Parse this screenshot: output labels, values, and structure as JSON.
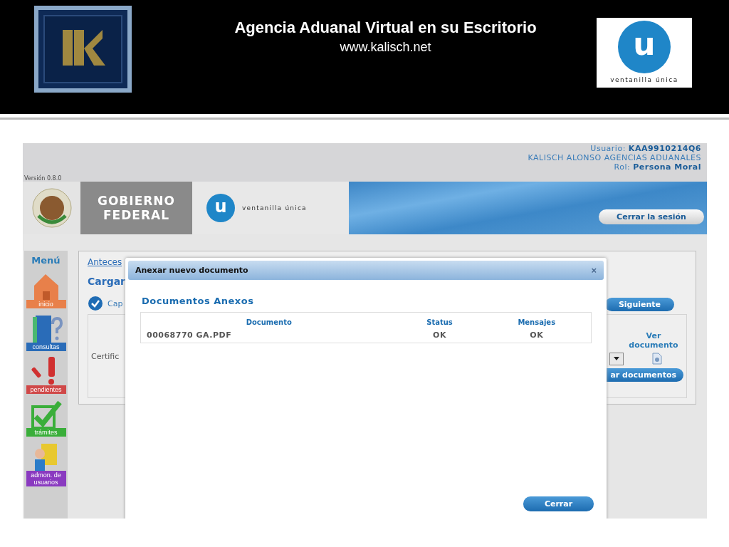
{
  "slide_header": {
    "title": "Agencia Aduanal Virtual en su Escritorio",
    "url": "www.kalisch.net",
    "logo_letter": "u",
    "logo_text": "ventanilla única"
  },
  "app": {
    "version": "Versión 0.8.0",
    "user": {
      "usuario_label": "Usuario:",
      "usuario": "KAA9910214Q6",
      "company": "KALISCH ALONSO AGENCIAS ADUANALES",
      "rol_label": "Rol:",
      "rol": "Persona Moral"
    },
    "banner": {
      "gobierno": "GOBIERNO FEDERAL",
      "logo_letter": "u",
      "logo_text": "ventanilla única",
      "logout": "Cerrar la sesión"
    },
    "menu": {
      "title": "Menú",
      "items": [
        {
          "label": "inicio",
          "kind": "house",
          "color": "#e8804a"
        },
        {
          "label": "consultas",
          "kind": "book",
          "color": "#2a6cb8"
        },
        {
          "label": "pendientes",
          "kind": "alert",
          "color": "#d04848"
        },
        {
          "label": "trámites",
          "kind": "check",
          "color": "#3aae3a"
        },
        {
          "label": "admon. de usuarios",
          "kind": "user",
          "color": "#8a3ac0"
        }
      ]
    },
    "page": {
      "breadcrumb": "Anteces",
      "heading": "Cargar",
      "step": "Cap",
      "next_button": "Siguiente",
      "field_label": "Certific",
      "view_column": "Ver documento",
      "attach_button": "ar documentos"
    },
    "dialog": {
      "title": "Anexar nuevo documento",
      "close": "×",
      "heading": "Documentos Anexos",
      "columns": [
        "Documento",
        "Status",
        "Mensajes"
      ],
      "rows": [
        [
          "00068770 GA.PDF",
          "OK",
          "OK"
        ]
      ],
      "button": "Cerrar"
    }
  }
}
